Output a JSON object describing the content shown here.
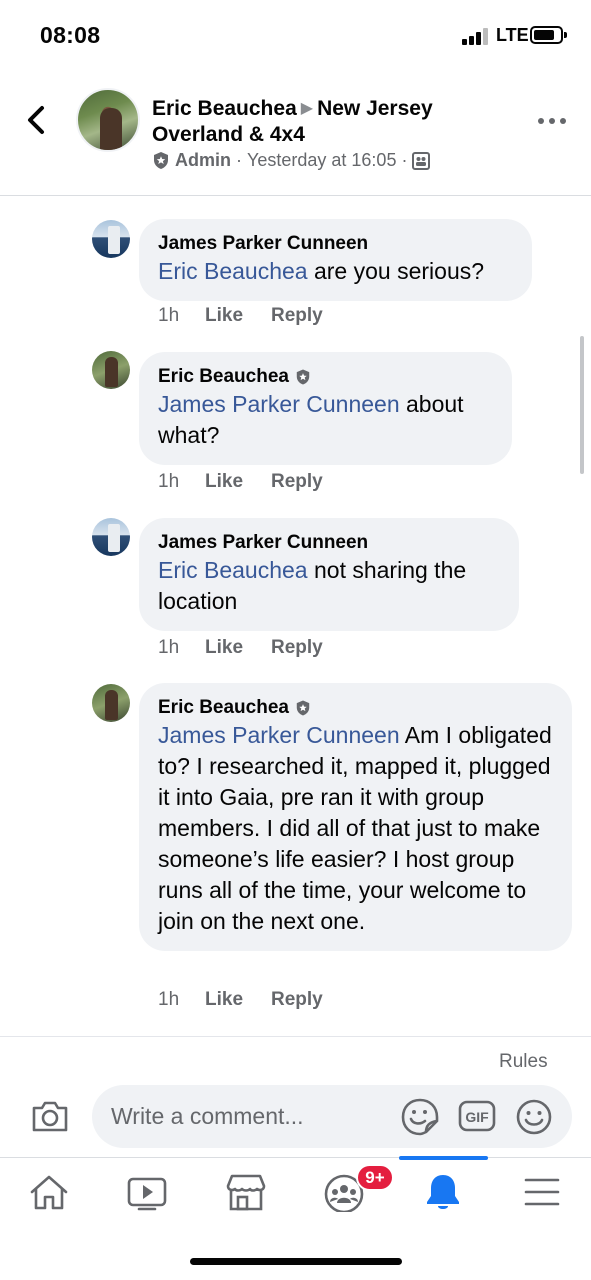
{
  "status_bar": {
    "time": "08:08",
    "network": "LTE"
  },
  "header": {
    "author": "Eric Beauchea",
    "group": "New Jersey Overland & 4x4",
    "role": "Admin",
    "separator": "·",
    "timestamp": "Yesterday at 16:05",
    "audience_icon": "group-audience-icon"
  },
  "comments": [
    {
      "author": "James Parker Cunneen",
      "is_admin": false,
      "mention": "Eric Beauchea",
      "text": " are you serious?",
      "time": "1h",
      "like": "Like",
      "reply": "Reply"
    },
    {
      "author": "Eric Beauchea",
      "is_admin": true,
      "mention": "James Parker Cunneen",
      "text": " about what?",
      "time": "1h",
      "like": "Like",
      "reply": "Reply"
    },
    {
      "author": "James Parker Cunneen",
      "is_admin": false,
      "mention": "Eric Beauchea",
      "text": " not sharing the location",
      "time": "1h",
      "like": "Like",
      "reply": "Reply"
    },
    {
      "author": "Eric Beauchea",
      "is_admin": true,
      "mention": "James Parker Cunneen",
      "text": " Am I obligated to? I researched it, mapped it, plugged it into Gaia, pre ran it with group members. I did all of that just to make someone’s life easier? I host group runs all of the time, your welcome to join on the next one.",
      "time": "1h",
      "like": "Like",
      "reply": "Reply"
    }
  ],
  "composer": {
    "rules": "Rules",
    "placeholder": "Write a comment...",
    "gif_label": "GIF"
  },
  "tabbar": {
    "items": [
      "home-icon",
      "video-icon",
      "marketplace-icon",
      "groups-icon",
      "notifications-icon",
      "menu-icon"
    ],
    "active": "notifications-icon",
    "groups_badge": "9+"
  },
  "colors": {
    "mention": "#385898",
    "bubble": "#f0f2f5",
    "accent": "#1877f2",
    "badge": "#e41e3f",
    "secondary_text": "#65676b"
  }
}
